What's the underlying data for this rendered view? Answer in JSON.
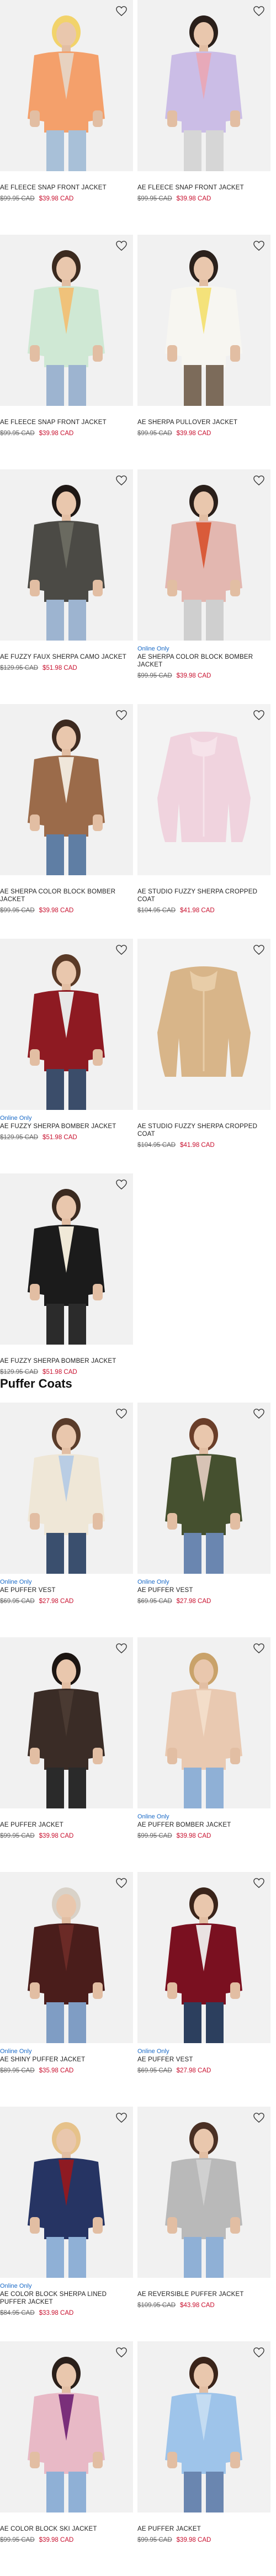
{
  "section_title": "Puffer Coats",
  "products_a": [
    {
      "badge": "",
      "name": "AE FLEECE SNAP FRONT JACKET",
      "old_price": "$99.95 CAD",
      "new_price": "$39.98 CAD",
      "colors": {
        "bg": "#f1f1f1",
        "coat": "#f4a06b",
        "accent": "#e7d2c0",
        "pants": "#a8c0d8",
        "hair": "#f2d36b"
      }
    },
    {
      "badge": "",
      "name": "AE FLEECE SNAP FRONT JACKET",
      "old_price": "$99.95 CAD",
      "new_price": "$39.98 CAD",
      "colors": {
        "bg": "#f1f1f1",
        "coat": "#cbbde6",
        "accent": "#e7a9b9",
        "pants": "#d6d6d6",
        "hair": "#2a1f1a"
      }
    },
    {
      "badge": "",
      "name": "AE FLEECE SNAP FRONT JACKET",
      "old_price": "$99.95 CAD",
      "new_price": "$39.98 CAD",
      "colors": {
        "bg": "#f1f1f1",
        "coat": "#cfe8d4",
        "accent": "#f0c27a",
        "pants": "#9db4d0",
        "hair": "#3b2a1f"
      }
    },
    {
      "badge": "",
      "name": "AE SHERPA PULLOVER JACKET",
      "old_price": "$99.95 CAD",
      "new_price": "$39.98 CAD",
      "colors": {
        "bg": "#f1f1f1",
        "coat": "#f7f6f1",
        "accent": "#f4e27a",
        "pants": "#7c6b5a",
        "hair": "#2b211c"
      }
    },
    {
      "badge": "",
      "name": "AE FUZZY FAUX SHERPA CAMO JACKET",
      "old_price": "$129.95 CAD",
      "new_price": "$51.98 CAD",
      "colors": {
        "bg": "#f1f1f1",
        "coat": "#4b4a45",
        "accent": "#6a6a60",
        "pants": "#9db4d0",
        "hair": "#1f1815"
      }
    },
    {
      "badge": "Online Only",
      "name": "AE SHERPA COLOR BLOCK BOMBER JACKET",
      "old_price": "$99.95 CAD",
      "new_price": "$39.98 CAD",
      "colors": {
        "bg": "#f1f1f1",
        "coat": "#e3b7b0",
        "accent": "#d95b3a",
        "pants": "#cfcfcf",
        "hair": "#2a1f1a"
      }
    },
    {
      "badge": "",
      "name": "AE SHERPA COLOR BLOCK BOMBER JACKET",
      "old_price": "$99.95 CAD",
      "new_price": "$39.98 CAD",
      "colors": {
        "bg": "#f1f1f1",
        "coat": "#9b6b4a",
        "accent": "#efe6da",
        "pants": "#5f7ea4",
        "hair": "#3d2a20"
      }
    },
    {
      "badge": "",
      "name": "AE STUDIO FUZZY SHERPA CROPPED COAT",
      "old_price": "$104.95 CAD",
      "new_price": "$41.98 CAD",
      "colors": {
        "bg": "#f3f3f3",
        "coat": "#f0d3de",
        "accent": "#f6e3ea",
        "pants": "#f3f3f3",
        "hair": "#f3f3f3"
      }
    },
    {
      "badge": "Online Only",
      "name": "AE FUZZY SHERPA BOMBER JACKET",
      "old_price": "$129.95 CAD",
      "new_price": "$51.98 CAD",
      "colors": {
        "bg": "#f1f1f1",
        "coat": "#8e1a22",
        "accent": "#e7e7e7",
        "pants": "#3b4d6a",
        "hair": "#5a3a27"
      }
    },
    {
      "badge": "",
      "name": "AE STUDIO FUZZY SHERPA CROPPED COAT",
      "old_price": "$104.95 CAD",
      "new_price": "$41.98 CAD",
      "colors": {
        "bg": "#f3f3f3",
        "coat": "#d8b589",
        "accent": "#e8cda8",
        "pants": "#f3f3f3",
        "hair": "#f3f3f3"
      }
    },
    {
      "badge": "",
      "name": "AE FUZZY SHERPA BOMBER JACKET",
      "old_price": "$129.95 CAD",
      "new_price": "$51.98 CAD",
      "colors": {
        "bg": "#f1f1f1",
        "coat": "#1b1b1b",
        "accent": "#f0e9d8",
        "pants": "#2b2b2b",
        "hair": "#3a2a20"
      }
    }
  ],
  "products_b": [
    {
      "badge": "Online Only",
      "name": "AE PUFFER VEST",
      "old_price": "$69.95 CAD",
      "new_price": "$27.98 CAD",
      "colors": {
        "bg": "#f1f1f1",
        "coat": "#efe7d7",
        "accent": "#b9cde4",
        "pants": "#3a4f6e",
        "hair": "#5a3c2a"
      }
    },
    {
      "badge": "Online Only",
      "name": "AE PUFFER VEST",
      "old_price": "$69.95 CAD",
      "new_price": "$27.98 CAD",
      "colors": {
        "bg": "#f1f1f1",
        "coat": "#45502f",
        "accent": "#d7c3b5",
        "pants": "#6a86b0",
        "hair": "#6a3e29"
      }
    },
    {
      "badge": "",
      "name": "AE PUFFER JACKET",
      "old_price": "$99.95 CAD",
      "new_price": "$39.98 CAD",
      "colors": {
        "bg": "#f1f1f1",
        "coat": "#3a2c26",
        "accent": "#4a3a32",
        "pants": "#2a2a2a",
        "hair": "#1c1512"
      }
    },
    {
      "badge": "Online Only",
      "name": "AE PUFFER BOMBER JACKET",
      "old_price": "$99.95 CAD",
      "new_price": "$39.98 CAD",
      "colors": {
        "bg": "#f1f1f1",
        "coat": "#e9c9b1",
        "accent": "#f3ddc9",
        "pants": "#8fb0d6",
        "hair": "#c9a26a"
      }
    },
    {
      "badge": "Online Only",
      "name": "AE SHINY PUFFER JACKET",
      "old_price": "$89.95 CAD",
      "new_price": "$35.98 CAD",
      "colors": {
        "bg": "#f1f1f1",
        "coat": "#4a1d1b",
        "accent": "#6b2a26",
        "pants": "#7f9dc4",
        "hair": "#d9d2c8"
      }
    },
    {
      "badge": "Online Only",
      "name": "AE PUFFER VEST",
      "old_price": "$69.95 CAD",
      "new_price": "$27.98 CAD",
      "colors": {
        "bg": "#f1f1f1",
        "coat": "#7a1020",
        "accent": "#e9e2e2",
        "pants": "#2c3f5e",
        "hair": "#3a241a"
      }
    },
    {
      "badge": "Online Only",
      "name": "AE COLOR BLOCK SHERPA LINED PUFFER JACKET",
      "old_price": "$84.95 CAD",
      "new_price": "$33.98 CAD",
      "colors": {
        "bg": "#f1f1f1",
        "coat": "#263463",
        "accent": "#8e1a22",
        "pants": "#8fb0d6",
        "hair": "#e6c28a"
      }
    },
    {
      "badge": "",
      "name": "AE REVERSIBLE PUFFER JACKET",
      "old_price": "$109.95 CAD",
      "new_price": "$43.98 CAD",
      "colors": {
        "bg": "#f1f1f1",
        "coat": "#b9b9b9",
        "accent": "#d0d0d0",
        "pants": "#8fb0d6",
        "hair": "#4a3024"
      }
    },
    {
      "badge": "",
      "name": "AE COLOR BLOCK SKI JACKET",
      "old_price": "$99.95 CAD",
      "new_price": "$39.98 CAD",
      "colors": {
        "bg": "#f1f1f1",
        "coat": "#e8b9c6",
        "accent": "#7a2f7a",
        "pants": "#8fb0d6",
        "hair": "#2a1f1a"
      }
    },
    {
      "badge": "",
      "name": "AE PUFFER JACKET",
      "old_price": "$99.95 CAD",
      "new_price": "$39.98 CAD",
      "colors": {
        "bg": "#f1f1f1",
        "coat": "#9ec4ea",
        "accent": "#c4dcf2",
        "pants": "#6a86b0",
        "hair": "#3a241a"
      }
    }
  ]
}
